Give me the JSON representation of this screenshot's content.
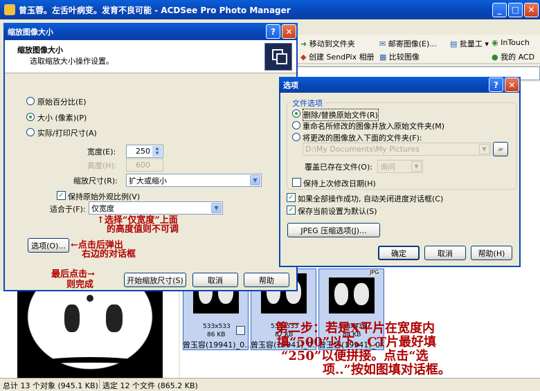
{
  "main_window": {
    "title": "曾玉蓉。左舌叶病变。发育不良可能 - ACDSee Pro Photo Manager",
    "toolbar": {
      "move_to_folder": "移动到文件夹",
      "email_images": "邮寄图像(E)...",
      "batch": "批量工",
      "intouch": "InTouch",
      "create_sendpix": "创建 SendPix 相册",
      "compare_images": "比较图像",
      "my_acd": "我的 ACD"
    },
    "status_bar": {
      "total": "总计 13 个对象 (945.1 KB)",
      "selected": "选定 12 个文件 (865.2 KB)"
    },
    "thumbnails": [
      {
        "size": "533x533",
        "kb": "86 KB",
        "name": "曾玉容(19941)_0..."
      },
      {
        "size": "533x533",
        "kb": "87 KB",
        "name": "曾玉容(19941)_0..."
      },
      {
        "size": "533x533",
        "kb": "84 KB",
        "name": "曾玉容(19941)_0..."
      }
    ],
    "jpg_badge": "JPG"
  },
  "resize_dialog": {
    "title": "缩放图像大小",
    "header_title": "缩放图像大小",
    "header_desc": "选取缩放大小操作设置。",
    "radio_percent": "原始百分比(E)",
    "radio_size": "大小 (像素)(P)",
    "radio_print": "实际/打印尺寸(A)",
    "width_label": "宽度(E):",
    "width_value": "250",
    "height_label": "高度(H):",
    "height_value": "600",
    "resize_label": "缩放尺寸(R):",
    "resize_value": "扩大或缩小",
    "keep_ratio": "保持原始外观比例(V)",
    "fit_label": "适合于(F):",
    "fit_value": "仅宽度",
    "options_button": "选项(O)...",
    "start_button": "开始缩放尺寸(S)",
    "cancel_button": "取消",
    "help_button": "帮助"
  },
  "options_dialog": {
    "title": "选项",
    "group_title": "文件选项",
    "radio_replace": "删除/替换原始文件(R)",
    "radio_rename": "重命名所修改的图像并放入原始文件夹(M)",
    "radio_folder": "将更改的图像放入下面的文件夹(F):",
    "folder_path": "D:\\My Documents\\My Pictures",
    "overwrite_label": "覆盖已存在文件(O):",
    "overwrite_value": "询问",
    "keep_date": "保持上次修改日期(H)",
    "auto_close": "如果全部操作成功, 自动关闭进度对话框(C)",
    "save_default": "保存当前设置为默认(S)",
    "jpeg_button": "JPEG 压缩选项(J)...",
    "ok_button": "确定",
    "cancel_button": "取消",
    "help_button": "帮助(H)"
  },
  "annotations": {
    "select_width": "↑选择“仅宽度”上面",
    "select_width2": "的高度值则不可调",
    "click_popup": "←点击后弹出",
    "click_popup2": "右边的对话框",
    "last_click": "最后点击→",
    "last_click2": "则完成",
    "step2_line1": "第二步：若是X平片在宽度内",
    "step2_line2": "填“500”以下。CT片最好填",
    "step2_line3": "“250”以便拼接。点击“选",
    "step2_line4": "项..”按如图填对话框。"
  },
  "colors": {
    "title_blue": "#0846b8",
    "annotation_red": "#b00000"
  }
}
